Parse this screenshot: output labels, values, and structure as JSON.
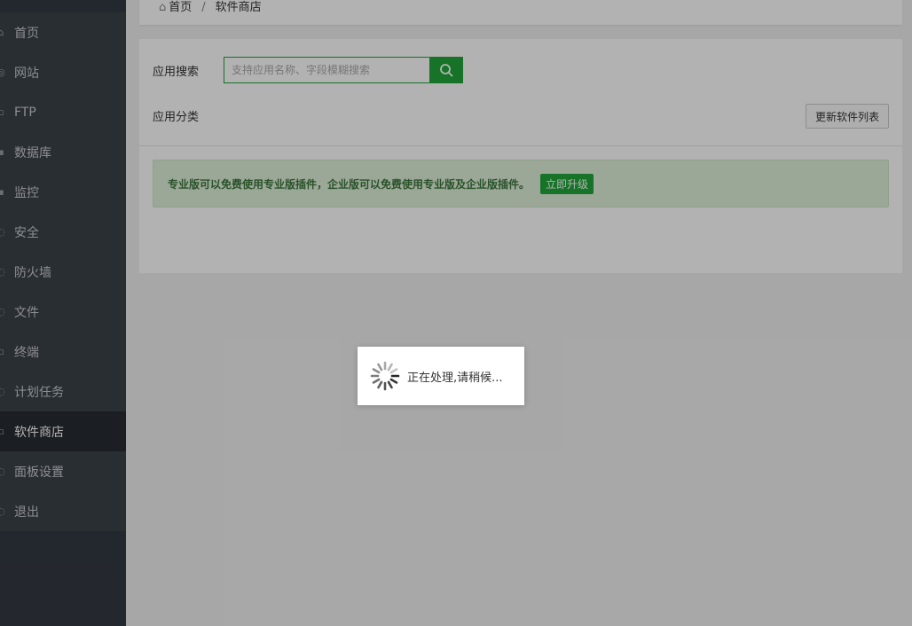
{
  "sidebar": {
    "items": [
      {
        "label": "首页",
        "icon": "home-icon",
        "active": false
      },
      {
        "label": "网站",
        "icon": "globe-icon",
        "active": false
      },
      {
        "label": "FTP",
        "icon": "ftp-icon",
        "active": false
      },
      {
        "label": "数据库",
        "icon": "database-icon",
        "active": false
      },
      {
        "label": "监控",
        "icon": "monitor-icon",
        "active": false
      },
      {
        "label": "安全",
        "icon": "shield-icon",
        "active": false
      },
      {
        "label": "防火墙",
        "icon": "firewall-icon",
        "active": false
      },
      {
        "label": "文件",
        "icon": "folder-icon",
        "active": false
      },
      {
        "label": "终端",
        "icon": "terminal-icon",
        "active": false
      },
      {
        "label": "计划任务",
        "icon": "clock-icon",
        "active": false
      },
      {
        "label": "软件商店",
        "icon": "store-icon",
        "active": true
      },
      {
        "label": "面板设置",
        "icon": "gear-icon",
        "active": false
      },
      {
        "label": "退出",
        "icon": "logout-icon",
        "active": false
      }
    ]
  },
  "breadcrumb": {
    "home": "首页",
    "separator": "/",
    "current": "软件商店"
  },
  "search": {
    "label": "应用搜索",
    "placeholder": "支持应用名称、字段模糊搜索"
  },
  "category": {
    "label": "应用分类"
  },
  "update_button": "更新软件列表",
  "alert": {
    "text": "专业版可以免费使用专业版插件，企业版可以免费使用专业版及企业版插件。",
    "button": "立即升级"
  },
  "loading": {
    "message": "正在处理,请稍候..."
  },
  "colors": {
    "accent": "#20a53a",
    "sidebar_bg": "#333a42",
    "sidebar_active": "#272c31"
  }
}
